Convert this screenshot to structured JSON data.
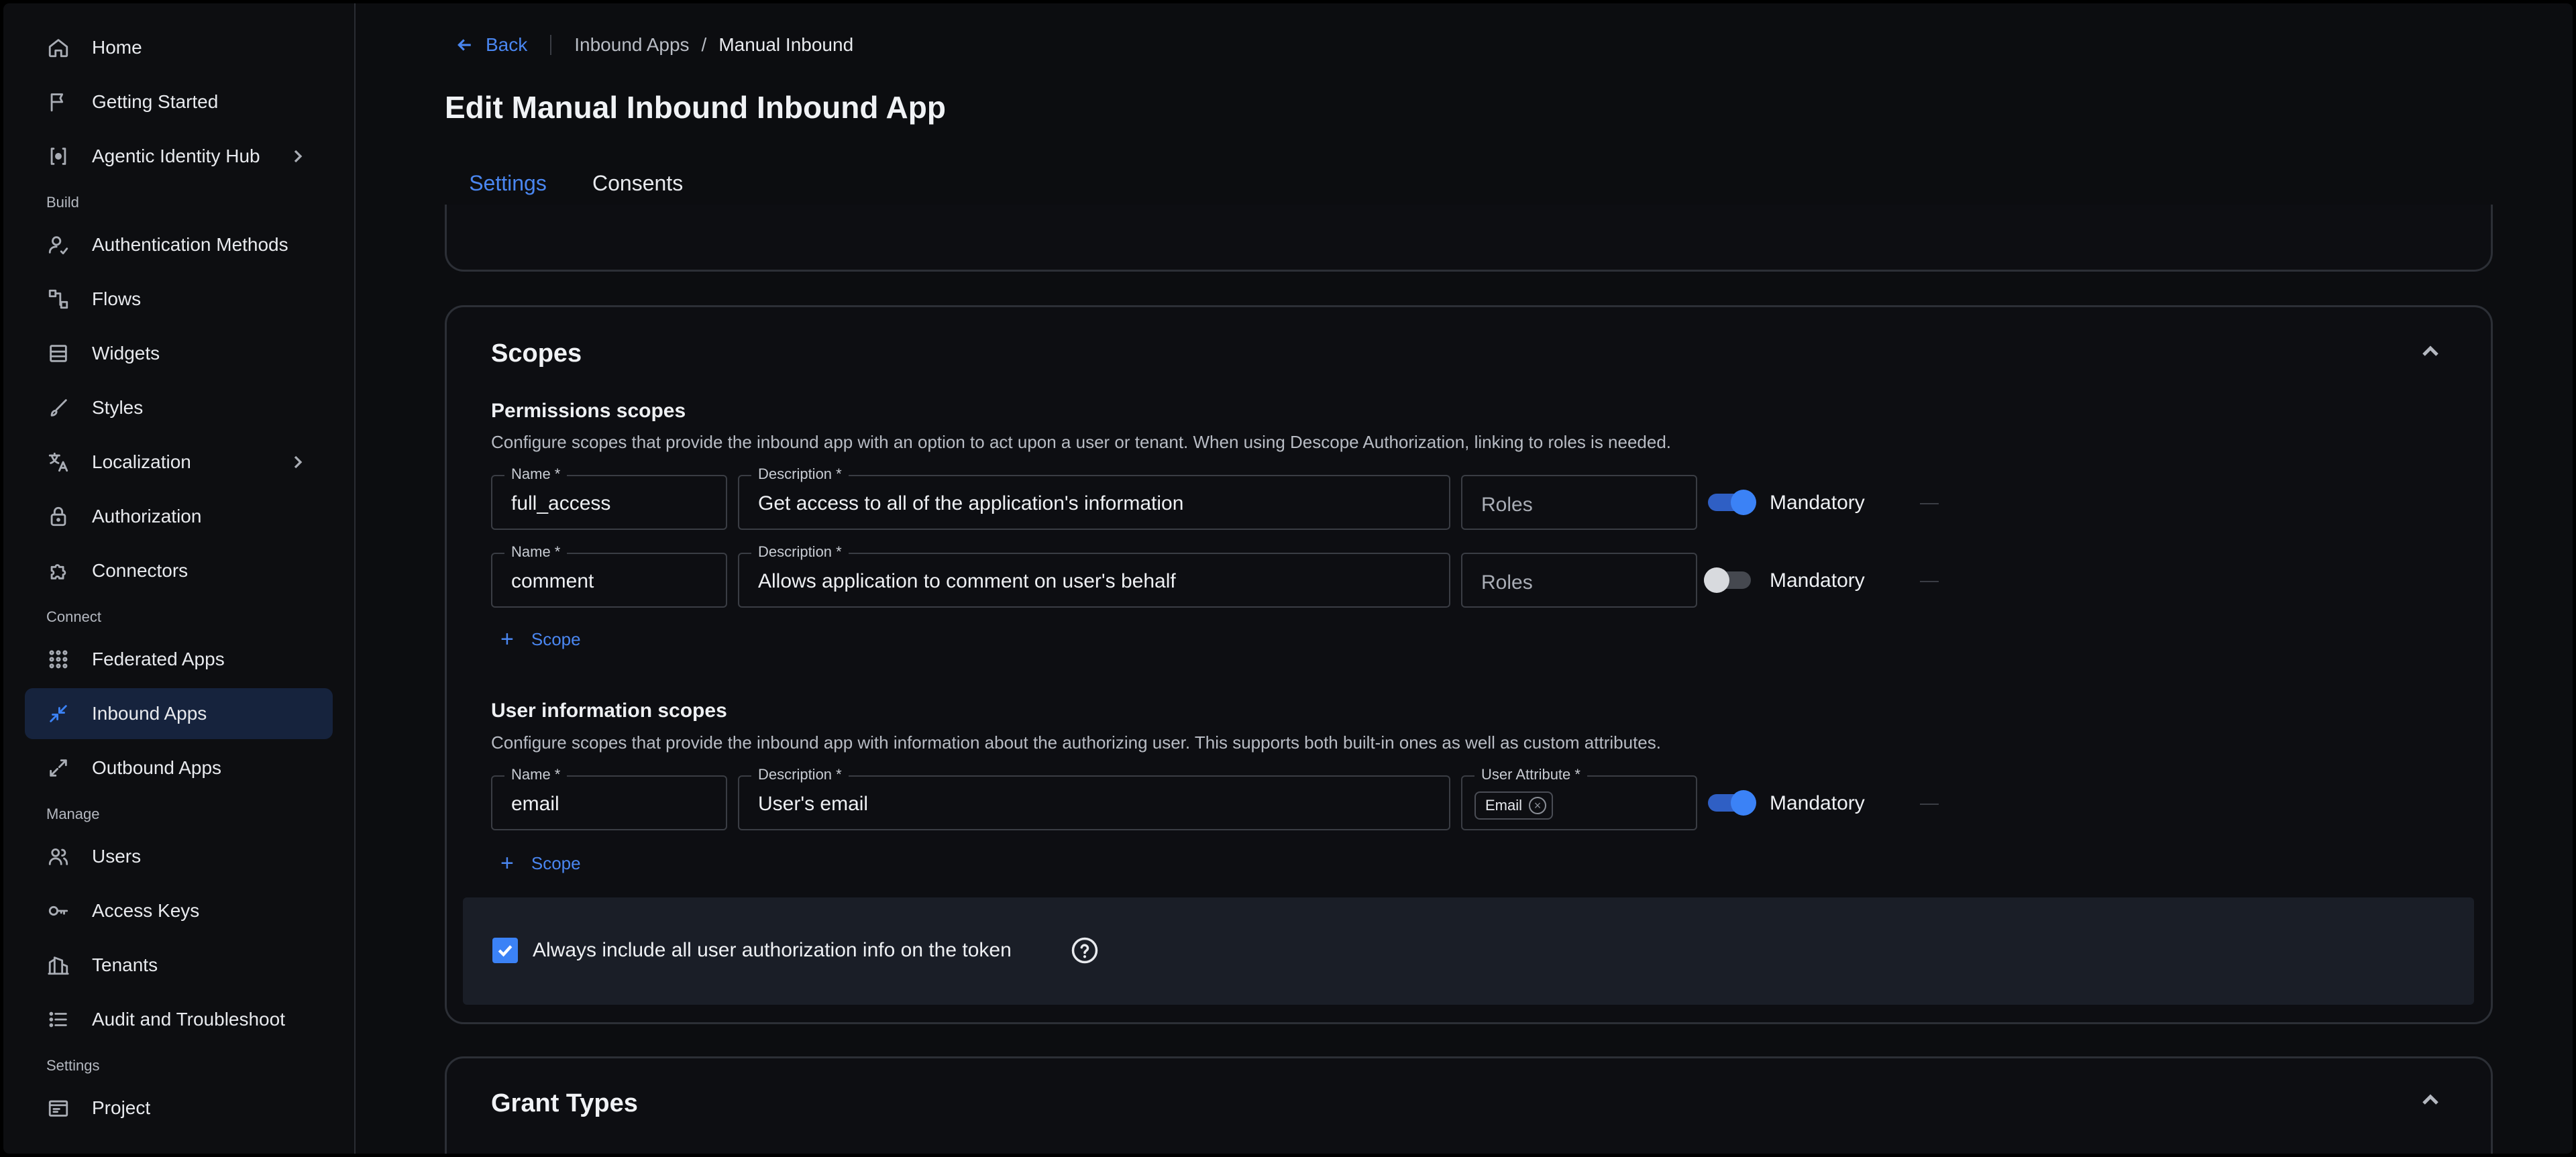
{
  "sidebar": {
    "items_top": [
      {
        "label": "Home",
        "icon": "home-icon"
      },
      {
        "label": "Getting Started",
        "icon": "flag-icon"
      },
      {
        "label": "Agentic Identity Hub",
        "icon": "agent-icon",
        "has_chevron": true
      }
    ],
    "sections": [
      {
        "label": "Build",
        "items": [
          {
            "label": "Authentication Methods",
            "icon": "user-key-icon"
          },
          {
            "label": "Flows",
            "icon": "flow-icon"
          },
          {
            "label": "Widgets",
            "icon": "widget-icon"
          },
          {
            "label": "Styles",
            "icon": "brush-icon"
          },
          {
            "label": "Localization",
            "icon": "translate-icon",
            "has_chevron": true
          },
          {
            "label": "Authorization",
            "icon": "lock-icon"
          },
          {
            "label": "Connectors",
            "icon": "puzzle-icon"
          }
        ]
      },
      {
        "label": "Connect",
        "items": [
          {
            "label": "Federated Apps",
            "icon": "grid-icon"
          },
          {
            "label": "Inbound Apps",
            "icon": "inbound-arrows-icon",
            "active": true
          },
          {
            "label": "Outbound Apps",
            "icon": "outbound-arrows-icon"
          }
        ]
      },
      {
        "label": "Manage",
        "items": [
          {
            "label": "Users",
            "icon": "users-icon"
          },
          {
            "label": "Access Keys",
            "icon": "key-icon"
          },
          {
            "label": "Tenants",
            "icon": "building-icon"
          },
          {
            "label": "Audit and Troubleshoot",
            "icon": "list-icon"
          }
        ]
      },
      {
        "label": "Settings",
        "items": [
          {
            "label": "Project",
            "icon": "project-icon"
          }
        ]
      }
    ]
  },
  "header": {
    "back_label": "Back",
    "breadcrumb_parent": "Inbound Apps",
    "breadcrumb_separator": "/",
    "breadcrumb_current": "Manual Inbound",
    "title": "Edit Manual Inbound Inbound App"
  },
  "tabs": [
    {
      "label": "Settings",
      "active": true
    },
    {
      "label": "Consents",
      "active": false
    }
  ],
  "scopes": {
    "title": "Scopes",
    "permissions": {
      "title": "Permissions scopes",
      "description": "Configure scopes that provide the inbound app with an option to act upon a user or tenant. When using Descope Authorization, linking to roles is needed.",
      "rows": [
        {
          "name_label": "Name *",
          "name": "full_access",
          "desc_label": "Description *",
          "description": "Get access to all of the application's information",
          "roles_placeholder": "Roles",
          "mandatory": true,
          "mandatory_label": "Mandatory"
        },
        {
          "name_label": "Name *",
          "name": "comment",
          "desc_label": "Description *",
          "description": "Allows application to comment on user's behalf",
          "roles_placeholder": "Roles",
          "mandatory": false,
          "mandatory_label": "Mandatory"
        }
      ],
      "add_label": "Scope"
    },
    "user_info": {
      "title": "User information scopes",
      "description": "Configure scopes that provide the inbound app with information about the authorizing user. This supports both built-in ones as well as custom attributes.",
      "rows": [
        {
          "name_label": "Name *",
          "name": "email",
          "desc_label": "Description *",
          "description": "User's email",
          "attr_label": "User Attribute *",
          "attr_chip": "Email",
          "mandatory": true,
          "mandatory_label": "Mandatory"
        }
      ],
      "add_label": "Scope"
    },
    "always_include": {
      "checked": true,
      "label": "Always include all user authorization info on the token"
    }
  },
  "grant_types": {
    "title": "Grant Types"
  },
  "colors": {
    "accent": "#3b82f6",
    "link": "#4a86f0",
    "active_nav_bg": "#16233d"
  }
}
